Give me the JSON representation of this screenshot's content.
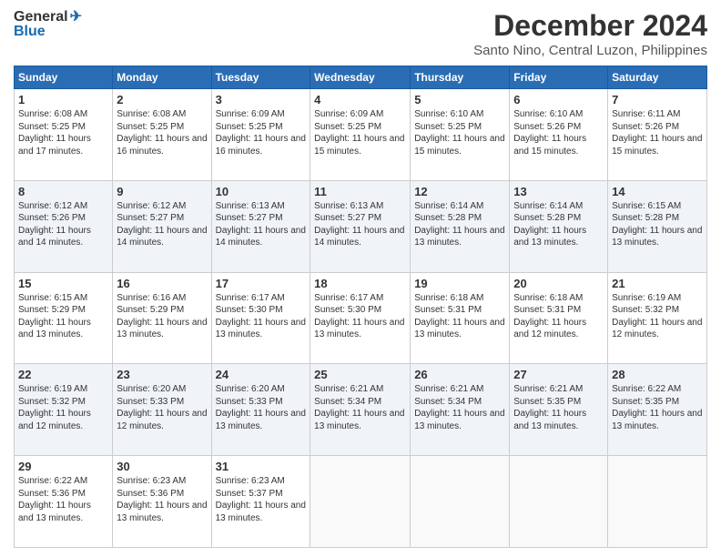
{
  "logo": {
    "line1": "General",
    "line2": "Blue"
  },
  "title": "December 2024",
  "subtitle": "Santo Nino, Central Luzon, Philippines",
  "days_of_week": [
    "Sunday",
    "Monday",
    "Tuesday",
    "Wednesday",
    "Thursday",
    "Friday",
    "Saturday"
  ],
  "weeks": [
    [
      {
        "day": "1",
        "sunrise": "6:08 AM",
        "sunset": "5:25 PM",
        "daylight": "11 hours and 17 minutes."
      },
      {
        "day": "2",
        "sunrise": "6:08 AM",
        "sunset": "5:25 PM",
        "daylight": "11 hours and 16 minutes."
      },
      {
        "day": "3",
        "sunrise": "6:09 AM",
        "sunset": "5:25 PM",
        "daylight": "11 hours and 16 minutes."
      },
      {
        "day": "4",
        "sunrise": "6:09 AM",
        "sunset": "5:25 PM",
        "daylight": "11 hours and 15 minutes."
      },
      {
        "day": "5",
        "sunrise": "6:10 AM",
        "sunset": "5:25 PM",
        "daylight": "11 hours and 15 minutes."
      },
      {
        "day": "6",
        "sunrise": "6:10 AM",
        "sunset": "5:26 PM",
        "daylight": "11 hours and 15 minutes."
      },
      {
        "day": "7",
        "sunrise": "6:11 AM",
        "sunset": "5:26 PM",
        "daylight": "11 hours and 15 minutes."
      }
    ],
    [
      {
        "day": "8",
        "sunrise": "6:12 AM",
        "sunset": "5:26 PM",
        "daylight": "11 hours and 14 minutes."
      },
      {
        "day": "9",
        "sunrise": "6:12 AM",
        "sunset": "5:27 PM",
        "daylight": "11 hours and 14 minutes."
      },
      {
        "day": "10",
        "sunrise": "6:13 AM",
        "sunset": "5:27 PM",
        "daylight": "11 hours and 14 minutes."
      },
      {
        "day": "11",
        "sunrise": "6:13 AM",
        "sunset": "5:27 PM",
        "daylight": "11 hours and 14 minutes."
      },
      {
        "day": "12",
        "sunrise": "6:14 AM",
        "sunset": "5:28 PM",
        "daylight": "11 hours and 13 minutes."
      },
      {
        "day": "13",
        "sunrise": "6:14 AM",
        "sunset": "5:28 PM",
        "daylight": "11 hours and 13 minutes."
      },
      {
        "day": "14",
        "sunrise": "6:15 AM",
        "sunset": "5:28 PM",
        "daylight": "11 hours and 13 minutes."
      }
    ],
    [
      {
        "day": "15",
        "sunrise": "6:15 AM",
        "sunset": "5:29 PM",
        "daylight": "11 hours and 13 minutes."
      },
      {
        "day": "16",
        "sunrise": "6:16 AM",
        "sunset": "5:29 PM",
        "daylight": "11 hours and 13 minutes."
      },
      {
        "day": "17",
        "sunrise": "6:17 AM",
        "sunset": "5:30 PM",
        "daylight": "11 hours and 13 minutes."
      },
      {
        "day": "18",
        "sunrise": "6:17 AM",
        "sunset": "5:30 PM",
        "daylight": "11 hours and 13 minutes."
      },
      {
        "day": "19",
        "sunrise": "6:18 AM",
        "sunset": "5:31 PM",
        "daylight": "11 hours and 13 minutes."
      },
      {
        "day": "20",
        "sunrise": "6:18 AM",
        "sunset": "5:31 PM",
        "daylight": "11 hours and 12 minutes."
      },
      {
        "day": "21",
        "sunrise": "6:19 AM",
        "sunset": "5:32 PM",
        "daylight": "11 hours and 12 minutes."
      }
    ],
    [
      {
        "day": "22",
        "sunrise": "6:19 AM",
        "sunset": "5:32 PM",
        "daylight": "11 hours and 12 minutes."
      },
      {
        "day": "23",
        "sunrise": "6:20 AM",
        "sunset": "5:33 PM",
        "daylight": "11 hours and 12 minutes."
      },
      {
        "day": "24",
        "sunrise": "6:20 AM",
        "sunset": "5:33 PM",
        "daylight": "11 hours and 13 minutes."
      },
      {
        "day": "25",
        "sunrise": "6:21 AM",
        "sunset": "5:34 PM",
        "daylight": "11 hours and 13 minutes."
      },
      {
        "day": "26",
        "sunrise": "6:21 AM",
        "sunset": "5:34 PM",
        "daylight": "11 hours and 13 minutes."
      },
      {
        "day": "27",
        "sunrise": "6:21 AM",
        "sunset": "5:35 PM",
        "daylight": "11 hours and 13 minutes."
      },
      {
        "day": "28",
        "sunrise": "6:22 AM",
        "sunset": "5:35 PM",
        "daylight": "11 hours and 13 minutes."
      }
    ],
    [
      {
        "day": "29",
        "sunrise": "6:22 AM",
        "sunset": "5:36 PM",
        "daylight": "11 hours and 13 minutes."
      },
      {
        "day": "30",
        "sunrise": "6:23 AM",
        "sunset": "5:36 PM",
        "daylight": "11 hours and 13 minutes."
      },
      {
        "day": "31",
        "sunrise": "6:23 AM",
        "sunset": "5:37 PM",
        "daylight": "11 hours and 13 minutes."
      },
      null,
      null,
      null,
      null
    ]
  ]
}
